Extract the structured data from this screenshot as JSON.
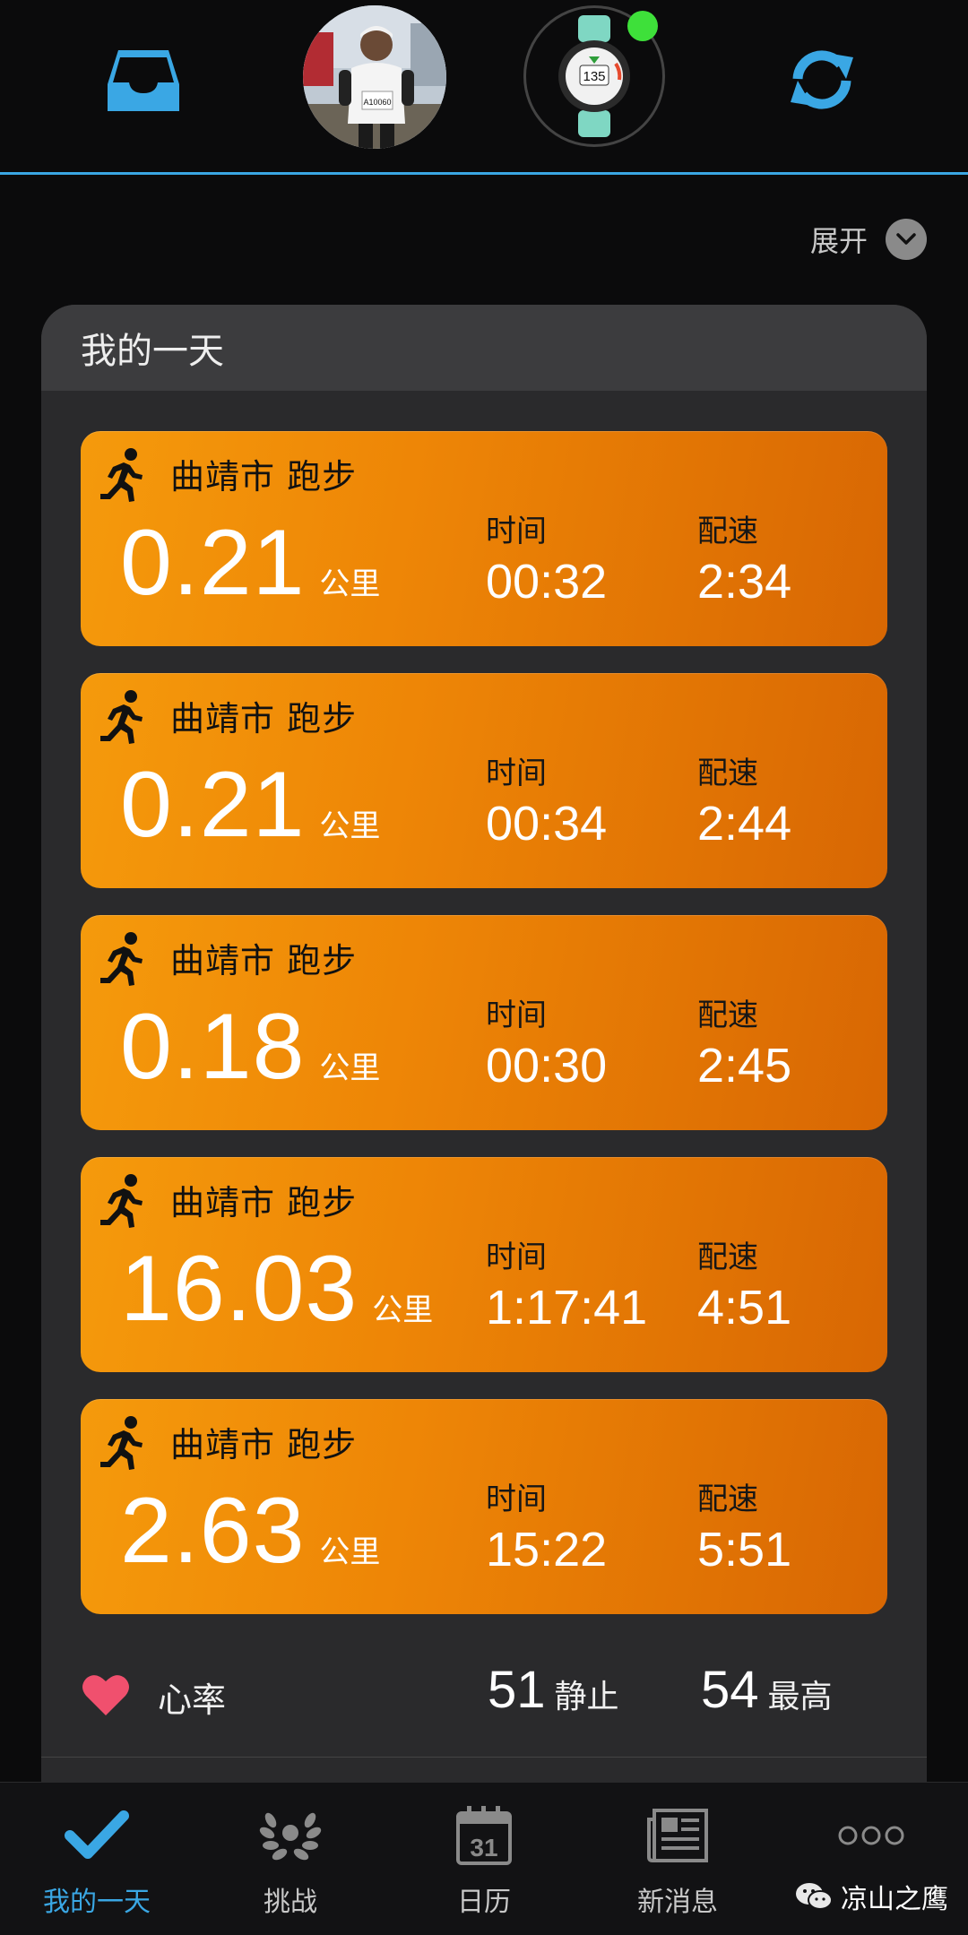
{
  "header": {
    "inbox_icon": "inbox-icon",
    "sync_icon": "sync-icon",
    "avatar_bib": "A10060",
    "watch_display_value": "135",
    "colors": {
      "accent": "#3aa7e4",
      "status_dot": "#3ee03a"
    }
  },
  "expand": {
    "label": "展开",
    "icon": "chevron-down-icon"
  },
  "panel": {
    "title": "我的一天"
  },
  "activities": [
    {
      "title": "曲靖市 跑步",
      "distance": "0.21",
      "distance_unit": "公里",
      "time_label": "时间",
      "time": "00:32",
      "pace_label": "配速",
      "pace": "2:34"
    },
    {
      "title": "曲靖市 跑步",
      "distance": "0.21",
      "distance_unit": "公里",
      "time_label": "时间",
      "time": "00:34",
      "pace_label": "配速",
      "pace": "2:44"
    },
    {
      "title": "曲靖市 跑步",
      "distance": "0.18",
      "distance_unit": "公里",
      "time_label": "时间",
      "time": "00:30",
      "pace_label": "配速",
      "pace": "2:45"
    },
    {
      "title": "曲靖市 跑步",
      "distance": "16.03",
      "distance_unit": "公里",
      "time_label": "时间",
      "time": "1:17:41",
      "pace_label": "配速",
      "pace": "4:51"
    },
    {
      "title": "曲靖市 跑步",
      "distance": "2.63",
      "distance_unit": "公里",
      "time_label": "时间",
      "time": "15:22",
      "pace_label": "配速",
      "pace": "5:51"
    }
  ],
  "heart_rate": {
    "label": "心率",
    "resting_value": "51",
    "resting_label": "静止",
    "max_value": "54",
    "max_label": "最高",
    "color": "#f0506e"
  },
  "nav": {
    "items": [
      {
        "label": "我的一天",
        "icon": "checkmark-icon",
        "active": true
      },
      {
        "label": "挑战",
        "icon": "laurel-icon",
        "active": false
      },
      {
        "label": "日历",
        "icon": "calendar-icon",
        "calendar_day": "31",
        "active": false
      },
      {
        "label": "新消息",
        "icon": "news-icon",
        "active": false
      },
      {
        "label": "",
        "icon": "more-icon",
        "active": false
      }
    ]
  },
  "watermark": {
    "text": "凉山之鹰",
    "icon": "wechat-icon"
  }
}
